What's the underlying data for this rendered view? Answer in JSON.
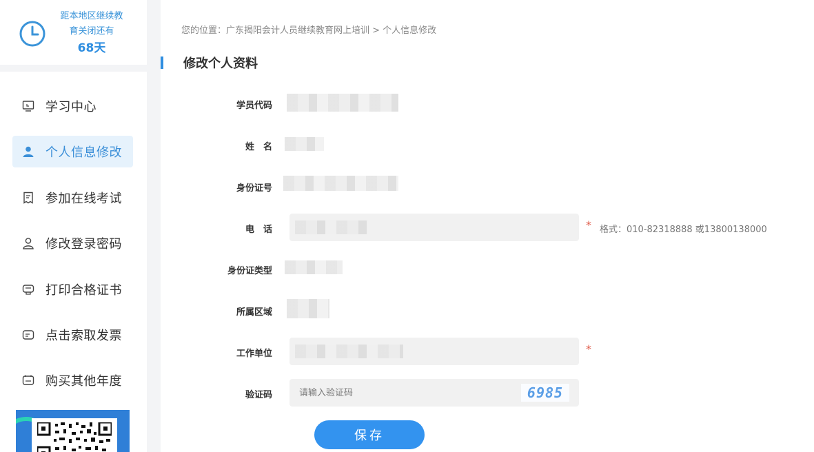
{
  "countdown": {
    "line1": "距本地区继续教",
    "line2": "育关闭还有",
    "days": "68天"
  },
  "menu": {
    "items": [
      {
        "label": "学习中心",
        "icon": "screen-icon",
        "active": false
      },
      {
        "label": "个人信息修改",
        "icon": "user-icon",
        "active": true
      },
      {
        "label": "参加在线考试",
        "icon": "exam-icon",
        "active": false
      },
      {
        "label": "修改登录密码",
        "icon": "user-outline-icon",
        "active": false
      },
      {
        "label": "打印合格证书",
        "icon": "certificate-icon",
        "active": false
      },
      {
        "label": "点击索取发票",
        "icon": "invoice-icon",
        "active": false
      },
      {
        "label": "购买其他年度",
        "icon": "purchase-icon",
        "active": false
      }
    ]
  },
  "breadcrumb": "您的位置：广东揭阳会计人员继续教育网上培训 > 个人信息修改",
  "section_title": "修改个人资料",
  "form": {
    "student_code_label": "学员代码",
    "name_label": "姓　名",
    "id_number_label": "身份证号",
    "phone_label": "电　话",
    "phone_hint": "格式：010-82318888 或13800138000",
    "id_type_label": "身份证类型",
    "region_label": "所属区域",
    "employer_label": "工作单位",
    "captcha_label": "验证码",
    "captcha_placeholder": "请输入验证码",
    "captcha_code": "6985",
    "required_mark": "*",
    "save_label": "保存"
  },
  "colors": {
    "accent": "#3393ef",
    "active_bg": "#e6f2fc",
    "required": "#e05c4b"
  }
}
